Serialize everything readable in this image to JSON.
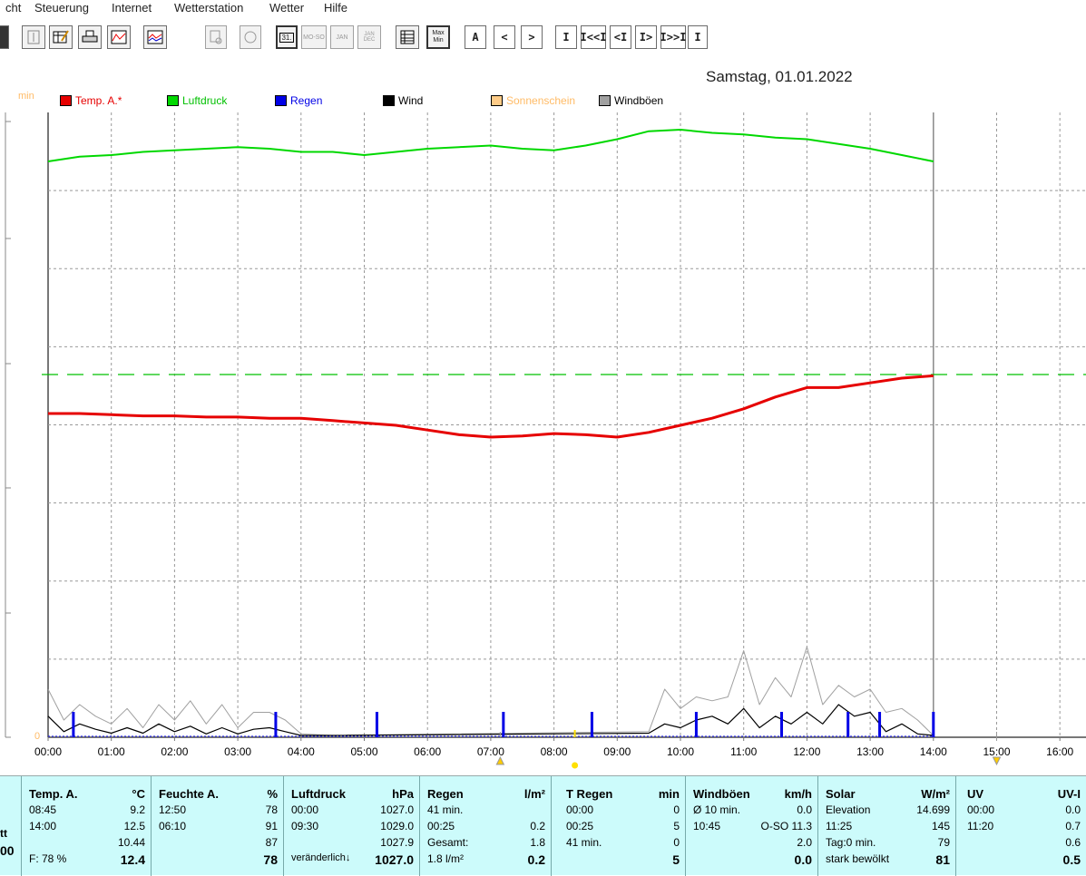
{
  "menu": [
    "cht",
    "Steuerung",
    "Internet",
    "Wetterstation",
    "Wetter",
    "Hilfe"
  ],
  "toolbar": {
    "nav_buttons": [
      "A",
      "<",
      ">",
      "I",
      "I<<I",
      "<I",
      "I>",
      "I>>I",
      "I"
    ],
    "view_labels": [
      "31.",
      "MO-SO",
      "JAN",
      "JAN DEC",
      "Max Min"
    ]
  },
  "chart": {
    "date": "Samstag, 01.01.2022",
    "min_label": "min",
    "zero_label": "0",
    "legend": [
      {
        "label": "Temp. A.*",
        "color": "#e60000",
        "text_color": "#e60000"
      },
      {
        "label": "Luftdruck",
        "color": "#00d800",
        "text_color": "#00c000"
      },
      {
        "label": "Regen",
        "color": "#0000e6",
        "text_color": "#0000e6"
      },
      {
        "label": "Wind",
        "color": "#000000",
        "text_color": "#000000"
      },
      {
        "label": "Sonnenschein",
        "color": "#ffcc88",
        "text_color": "#ffbb66"
      },
      {
        "label": "Windböen",
        "color": "#a0a0a0",
        "text_color": "#000000"
      }
    ],
    "x_ticks": [
      "00:00",
      "01:00",
      "02:00",
      "03:00",
      "04:00",
      "05:00",
      "06:00",
      "07:00",
      "08:00",
      "09:00",
      "10:00",
      "11:00",
      "12:00",
      "13:00",
      "14:00",
      "15:00",
      "16:00"
    ]
  },
  "chart_data": {
    "type": "line",
    "title": "Samstag, 01.01.2022",
    "x_unit": "hour",
    "xlim": [
      0,
      16.5
    ],
    "series": [
      {
        "name": "Luftdruck",
        "color": "#00d800",
        "x": [
          0,
          0.5,
          1,
          1.5,
          2,
          2.5,
          3,
          3.5,
          4,
          4.5,
          5,
          5.5,
          6,
          6.5,
          7,
          7.5,
          8,
          8.5,
          9,
          9.5,
          10,
          10.5,
          11,
          11.5,
          12,
          12.5,
          13,
          13.5,
          14
        ],
        "y": [
          1027.0,
          1027.3,
          1027.4,
          1027.6,
          1027.7,
          1027.8,
          1027.9,
          1027.8,
          1027.6,
          1027.6,
          1027.4,
          1027.6,
          1027.8,
          1027.9,
          1028.0,
          1027.8,
          1027.7,
          1028.0,
          1028.4,
          1028.9,
          1029.0,
          1028.8,
          1028.7,
          1028.5,
          1028.4,
          1028.1,
          1027.8,
          1027.4,
          1027.0
        ]
      },
      {
        "name": "Temp. A.*",
        "color": "#e60000",
        "x": [
          0,
          0.5,
          1,
          1.5,
          2,
          2.5,
          3,
          3.5,
          4,
          4.5,
          5,
          5.5,
          6,
          6.5,
          7,
          7.5,
          8,
          8.5,
          9,
          9.5,
          10,
          10.5,
          11,
          11.5,
          12,
          12.5,
          13,
          13.5,
          14
        ],
        "y": [
          10.9,
          10.9,
          10.85,
          10.8,
          10.8,
          10.75,
          10.75,
          10.7,
          10.7,
          10.6,
          10.5,
          10.4,
          10.2,
          10.0,
          9.9,
          9.95,
          10.05,
          10.0,
          9.9,
          10.1,
          10.4,
          10.7,
          11.1,
          11.6,
          12.0,
          12.0,
          12.2,
          12.4,
          12.5
        ]
      },
      {
        "name": "Windböen",
        "color": "#a0a0a0",
        "x": [
          0,
          0.25,
          0.5,
          0.75,
          1,
          1.25,
          1.5,
          1.75,
          2,
          2.25,
          2.5,
          2.75,
          3,
          3.25,
          3.5,
          3.75,
          4,
          4.5,
          9.5,
          9.75,
          10,
          10.25,
          10.5,
          10.75,
          11,
          11.25,
          11.5,
          11.75,
          12,
          12.25,
          12.5,
          12.75,
          13,
          13.25,
          13.5,
          13.75,
          14
        ],
        "y": [
          6.0,
          2.0,
          4.0,
          2.5,
          1.5,
          3.5,
          1.0,
          4.0,
          2.0,
          4.5,
          1.5,
          4.0,
          1.0,
          3.0,
          3.0,
          2.0,
          0.2,
          0,
          0.5,
          6.0,
          3.5,
          5.0,
          4.5,
          5.0,
          11.0,
          4.0,
          7.5,
          5.0,
          11.5,
          4.0,
          6.5,
          5.0,
          6.0,
          3.0,
          3.5,
          2.0,
          0
        ]
      },
      {
        "name": "Wind",
        "color": "#000000",
        "x": [
          0,
          0.25,
          0.5,
          0.75,
          1,
          1.25,
          1.5,
          1.75,
          2,
          2.25,
          2.5,
          2.75,
          3,
          3.25,
          3.5,
          3.75,
          4,
          4.5,
          9.5,
          9.75,
          10,
          10.25,
          10.5,
          10.75,
          11,
          11.25,
          11.5,
          11.75,
          12,
          12.25,
          12.5,
          12.75,
          13,
          13.25,
          13.5,
          13.75,
          14
        ],
        "y": [
          2.5,
          0.5,
          1.5,
          0.8,
          0.3,
          1.0,
          0.3,
          1.5,
          0.5,
          1.2,
          0.2,
          1.0,
          0.2,
          0.8,
          1.0,
          0.5,
          0,
          0,
          0.3,
          1.5,
          1.0,
          2.0,
          2.5,
          1.5,
          3.5,
          1.0,
          2.5,
          1.5,
          3.0,
          1.5,
          4.0,
          2.5,
          3.0,
          0.5,
          1.5,
          0.2,
          0
        ]
      },
      {
        "name": "Regen",
        "color": "#0000e6",
        "x": [
          0.4,
          3.6,
          5.2,
          7.2,
          8.6,
          10.25,
          11.6,
          12.65,
          13.15,
          14.0
        ],
        "y": [
          2.0,
          2.0,
          2.0,
          2.0,
          2.0,
          2.0,
          2.0,
          2.0,
          2.0,
          2.0
        ]
      }
    ]
  },
  "panel": {
    "c0": {
      "r3": "tt",
      "r4": "00"
    },
    "temp": {
      "h1": "Temp. A.",
      "h2": "°C",
      "r1a": "08:45",
      "r1b": "9.2",
      "r2a": "14:00",
      "r2b": "12.5",
      "r3b": "10.44",
      "r4a": "F: 78 %",
      "r4b": "12.4"
    },
    "feuchte": {
      "h1": "Feuchte A.",
      "h2": "%",
      "r1a": "12:50",
      "r1b": "78",
      "r2a": "06:10",
      "r2b": "91",
      "r3b": "87",
      "r4b": "78"
    },
    "luft": {
      "h1": "Luftdruck",
      "h2": "hPa",
      "r1a": "00:00",
      "r1b": "1027.0",
      "r2a": "09:30",
      "r2b": "1029.0",
      "r3b": "1027.9",
      "r4a": "veränderlich",
      "r4b": "1027.0"
    },
    "regen": {
      "h1": "Regen",
      "h2": "l/m²",
      "r1a": "41 min.",
      "r2a": "00:25",
      "r2b": "0.2",
      "r3a": "Gesamt:",
      "r3b": "1.8",
      "r4a": "1.8 l/m²",
      "r4b": "0.2"
    },
    "tregen": {
      "h1": "T Regen",
      "h2": "min",
      "r1a": "00:00",
      "r1b": "0",
      "r2a": "00:25",
      "r2b": "5",
      "r3a": "41 min.",
      "r3b": "0",
      "r4b": "5"
    },
    "wind": {
      "h1": "Windböen",
      "h2": "km/h",
      "r1a": "Ø 10 min.",
      "r1b": "0.0",
      "r2a": "10:45",
      "r2b": "O-SO 11.3",
      "r3b": "2.0",
      "r4b": "0.0"
    },
    "solar": {
      "h1": "Solar",
      "h2": "W/m²",
      "r1a": "Elevation",
      "r1b": "14.699",
      "r2a": "11:25",
      "r2b": "145",
      "r3a": "Tag:0 min.",
      "r3b": "79",
      "r4a": "stark bewölkt",
      "r4b": "81"
    },
    "uv": {
      "h1": "UV",
      "h2": "UV-I",
      "r1a": "00:00",
      "r1b": "0.0",
      "r2a": "11:20",
      "r2b": "0.7",
      "r3b": "0.6",
      "r4b": "0.5"
    }
  }
}
